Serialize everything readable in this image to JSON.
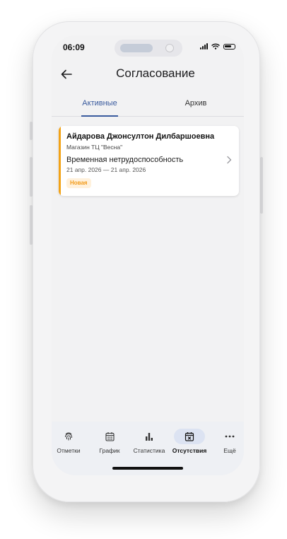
{
  "status": {
    "time": "06:09"
  },
  "header": {
    "title": "Согласование"
  },
  "tabs": [
    {
      "label": "Активные",
      "active": true
    },
    {
      "label": "Архив",
      "active": false
    }
  ],
  "requests": [
    {
      "name": "Айдарова Джонсултон Дилбаршоевна",
      "store": "Магазин ТЦ \"Весна\"",
      "type": "Временная нетрудоспособность",
      "dates": "21 апр. 2026 — 21 апр. 2026",
      "status": "Новая"
    }
  ],
  "bottom_nav": [
    {
      "label": "Отметки",
      "icon": "fingerprint-icon",
      "active": false
    },
    {
      "label": "График",
      "icon": "calendar-icon",
      "active": false
    },
    {
      "label": "Статистика",
      "icon": "bar-chart-icon",
      "active": false
    },
    {
      "label": "Отсутствия",
      "icon": "calendar-x-icon",
      "active": true
    },
    {
      "label": "Ещё",
      "icon": "more-icon",
      "active": false
    }
  ],
  "colors": {
    "accent": "#3a5b9e",
    "new_badge": "#f29b1a",
    "card_stripe": "#f2a216"
  }
}
